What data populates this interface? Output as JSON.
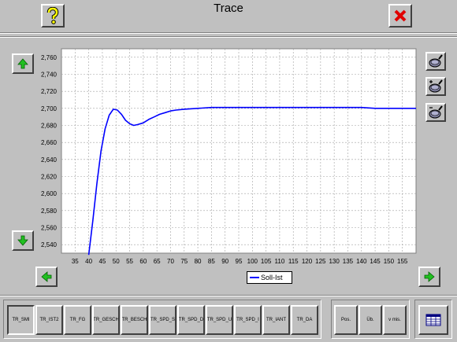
{
  "window": {
    "title": "Trace"
  },
  "header": {
    "help_icon": "question-mark-icon",
    "close_icon": "red-x-icon"
  },
  "side_tools": [
    "zoom-tool-icon",
    "zoom-in-tool-icon",
    "zoom-out-tool-icon"
  ],
  "chart_data": {
    "type": "line",
    "x_ticks": [
      "35",
      "40",
      "45",
      "50",
      "55",
      "60",
      "65",
      "70",
      "75",
      "80",
      "85",
      "90",
      "95",
      "100",
      "105",
      "110",
      "115",
      "120",
      "125",
      "130",
      "135",
      "140",
      "145",
      "150",
      "155"
    ],
    "y_ticks": [
      "2,540",
      "2,560",
      "2,580",
      "2,600",
      "2,620",
      "2,640",
      "2,660",
      "2,680",
      "2,700",
      "2,720",
      "2,740",
      "2,760"
    ],
    "xlim": [
      30,
      160
    ],
    "ylim": [
      2.53,
      2.77
    ],
    "grid": true,
    "legend_placement": "bottom-center",
    "series": [
      {
        "name": "Soll-Ist",
        "color": "#0000ff",
        "x": [
          40.0,
          41.5,
          43.0,
          44.5,
          46.0,
          47.5,
          49.0,
          50.5,
          52.0,
          53.5,
          55.0,
          56.5,
          58.0,
          60.0,
          62.0,
          64.0,
          66.0,
          68.0,
          70.0,
          72.0,
          75.0,
          80.0,
          85.0,
          90.0,
          100.0,
          110.0,
          120.0,
          130.0,
          140.0,
          145.0,
          150.0,
          155.0,
          160.0
        ],
        "y": [
          2.528,
          2.568,
          2.612,
          2.65,
          2.676,
          2.692,
          2.699,
          2.698,
          2.693,
          2.686,
          2.682,
          2.68,
          2.681,
          2.683,
          2.687,
          2.69,
          2.693,
          2.695,
          2.697,
          2.698,
          2.699,
          2.7,
          2.701,
          2.701,
          2.701,
          2.701,
          2.701,
          2.701,
          2.701,
          2.7,
          2.7,
          2.7,
          2.7
        ]
      }
    ]
  },
  "tabs": [
    {
      "label": "TR_SMI",
      "active": true
    },
    {
      "label": "TR_IST2",
      "active": false
    },
    {
      "label": "TR_FG",
      "active": false
    },
    {
      "label": "TR_GESCH",
      "active": false
    },
    {
      "label": "TR_BESCH",
      "active": false
    },
    {
      "label": "TR_SPD_S",
      "active": false
    },
    {
      "label": "TR_SPD_D",
      "active": false
    },
    {
      "label": "TR_SPD_U",
      "active": false
    },
    {
      "label": "TR_SPD_I",
      "active": false
    },
    {
      "label": "TR_IANT",
      "active": false
    },
    {
      "label": "TR_DA",
      "active": false
    }
  ],
  "right_buttons": [
    "Pos.",
    "Üb.",
    "v mis."
  ],
  "table_icon": "table-view-icon"
}
